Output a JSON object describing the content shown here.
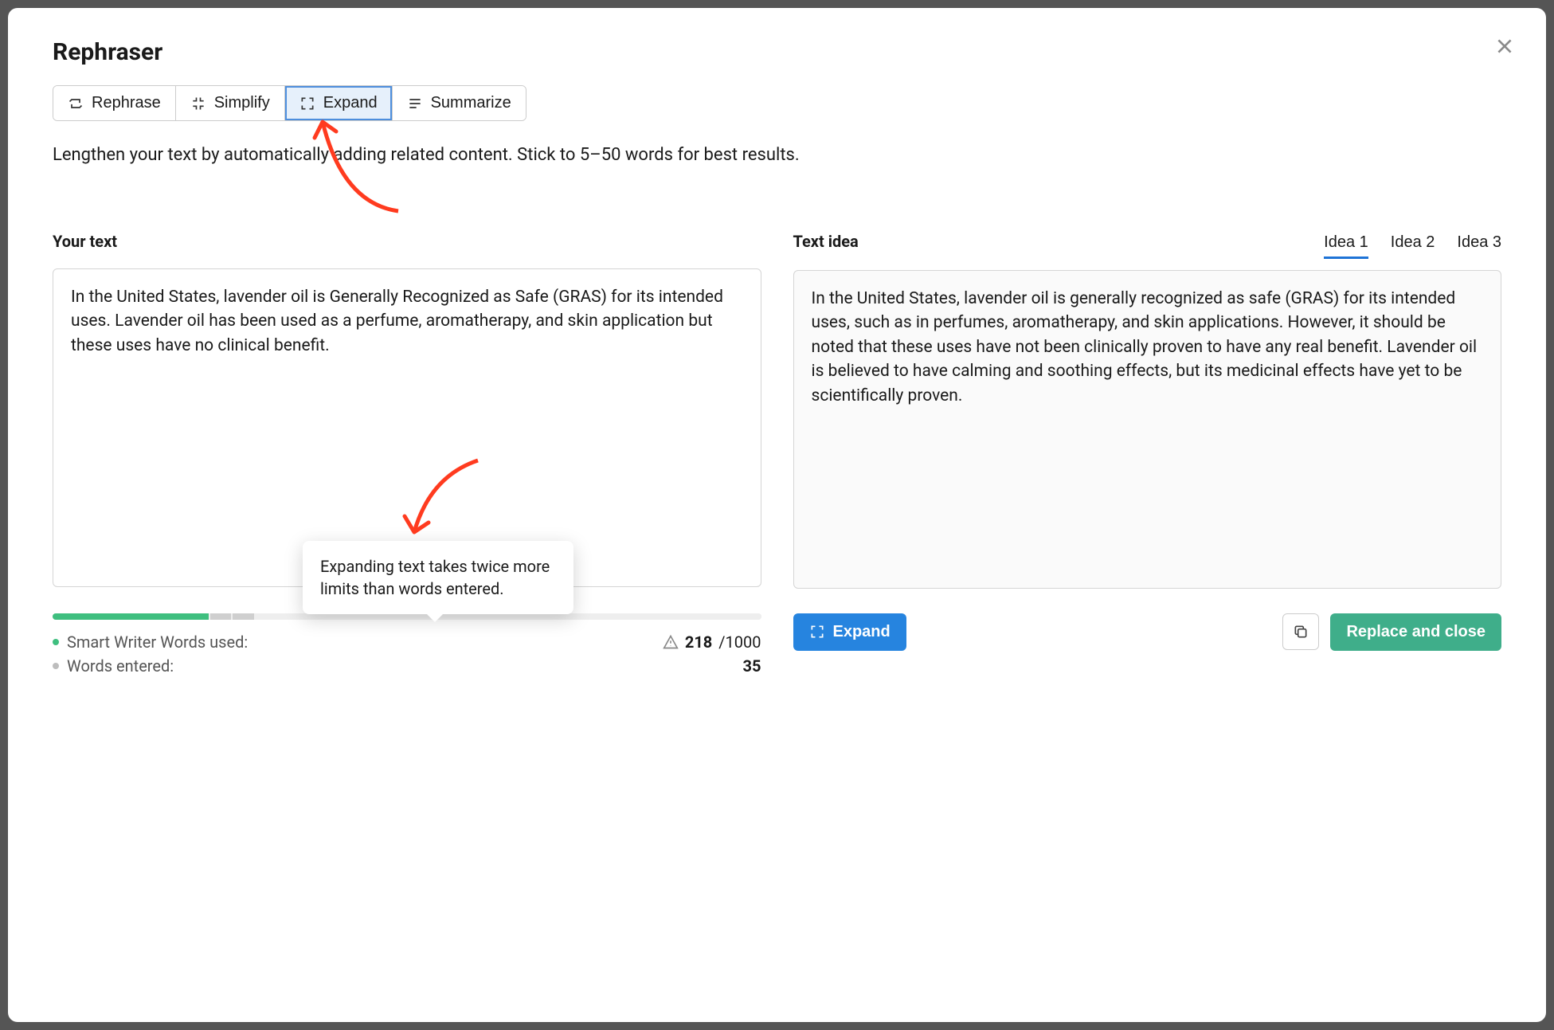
{
  "title": "Rephraser",
  "tabs": {
    "rephrase": "Rephrase",
    "simplify": "Simplify",
    "expand": "Expand",
    "summarize": "Summarize"
  },
  "active_tab": "expand",
  "description": "Lengthen your text by automatically adding related content. Stick to 5–50 words for best results.",
  "left": {
    "label": "Your text",
    "value": "In the United States, lavender oil is Generally Recognized as Safe (GRAS) for its intended uses. Lavender oil has been used as a perfume, aromatherapy, and skin application but these uses have no clinical benefit."
  },
  "right": {
    "label": "Text idea",
    "ideas": [
      "Idea 1",
      "Idea 2",
      "Idea 3"
    ],
    "active_idea": 0,
    "value": "In the United States, lavender oil is generally recognized as safe (GRAS) for its intended uses, such as in perfumes, aromatherapy, and skin applications. However, it should be noted that these uses have not been clinically proven to have any real benefit. Lavender oil is believed to have calming and soothing effects, but its medicinal effects have yet to be scientifically proven."
  },
  "stats": {
    "used_label": "Smart Writer Words used:",
    "used": "218",
    "limit": "/1000",
    "entered_label": "Words entered:",
    "entered": "35"
  },
  "tooltip": "Expanding text takes twice more limits than words entered.",
  "actions": {
    "expand": "Expand",
    "replace": "Replace and close"
  }
}
